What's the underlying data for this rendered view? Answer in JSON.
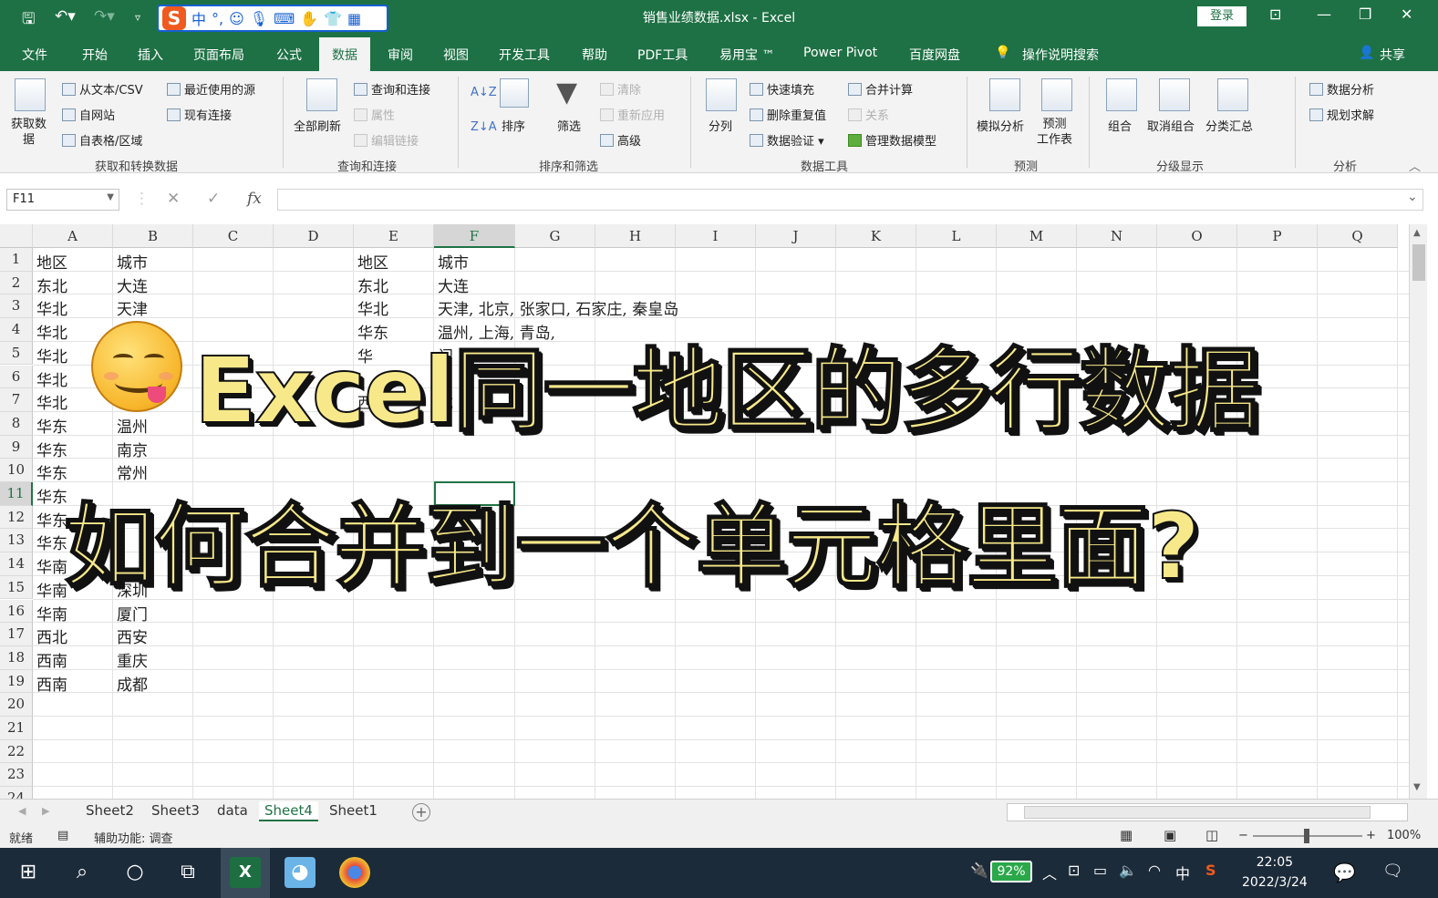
{
  "window": {
    "title": "销售业绩数据.xlsx  -  Excel",
    "login": "登录",
    "sogou_logo": "S",
    "sogou_mode": "中"
  },
  "tabs": [
    "文件",
    "开始",
    "插入",
    "页面布局",
    "公式",
    "数据",
    "审阅",
    "视图",
    "开发工具",
    "帮助",
    "PDF工具",
    "易用宝 ™",
    "Power Pivot",
    "百度网盘",
    "操作说明搜索"
  ],
  "share": "共享",
  "ribbon": {
    "get_data": "获取数\n据",
    "from_text": "从文本/CSV",
    "recent_sources": "最近使用的源",
    "from_web": "自网站",
    "existing_conn": "现有连接",
    "from_table": "自表格/区域",
    "group_get": "获取和转换数据",
    "refresh_all": "全部刷新",
    "queries_conn": "查询和连接",
    "properties": "属性",
    "edit_links": "编辑链接",
    "group_query": "查询和连接",
    "sort": "排序",
    "filter": "筛选",
    "clear": "清除",
    "reapply": "重新应用",
    "advanced": "高级",
    "group_sort": "排序和筛选",
    "text_to_col": "分列",
    "flash_fill": "快速填充",
    "remove_dup": "删除重复值",
    "data_validation": "数据验证",
    "consolidate": "合并计算",
    "relationships": "关系",
    "data_model": "管理数据模型",
    "group_tools": "数据工具",
    "what_if": "模拟分析",
    "forecast_sheet": "预测\n工作表",
    "group_forecast": "预测",
    "group_btn": "组合",
    "ungroup": "取消组合",
    "subtotal": "分类汇总",
    "group_outline": "分级显示",
    "data_analysis": "数据分析",
    "solver": "规划求解",
    "group_analysis": "分析"
  },
  "formula_bar": {
    "name_box": "F11",
    "fx": "fx",
    "cancel": "✕",
    "enter": "✓"
  },
  "columns": [
    "A",
    "B",
    "C",
    "D",
    "E",
    "F",
    "G",
    "H",
    "I",
    "J",
    "K",
    "L",
    "M",
    "N",
    "O",
    "P",
    "Q"
  ],
  "rows": [
    "1",
    "2",
    "3",
    "4",
    "5",
    "6",
    "7",
    "8",
    "9",
    "10",
    "11",
    "12",
    "13",
    "14",
    "15",
    "16",
    "17",
    "18",
    "19",
    "20",
    "21",
    "22",
    "23",
    "24"
  ],
  "cells": {
    "A": [
      "地区",
      "东北",
      "华北",
      "华北",
      "华北",
      "华北",
      "华北",
      "华东",
      "华东",
      "华东",
      "华东",
      "华东",
      "华东",
      "华南",
      "华南",
      "华南",
      "西北",
      "西南",
      "西南"
    ],
    "B": [
      "城市",
      "大连",
      "天津",
      "",
      "",
      "",
      "",
      "温州",
      "南京",
      "常州",
      "",
      "",
      "",
      "",
      "深圳",
      "厦门",
      "西安",
      "重庆",
      "成都"
    ],
    "E": [
      "地区",
      "东北",
      "华北",
      "华东",
      "华",
      "",
      "西"
    ],
    "F": [
      "城市",
      "大连",
      "天津, 北京, 张家口, 石家庄, 秦皇岛",
      "温州, 上海, 青岛, ",
      "门",
      "",
      "成"
    ]
  },
  "overlay": {
    "line1": "Excel同一地区的多行数据",
    "line2": "如何合并到一个单元格里面?"
  },
  "sheets": [
    "Sheet2",
    "Sheet3",
    "data",
    "Sheet4",
    "Sheet1"
  ],
  "active_sheet": "Sheet4",
  "status": {
    "ready": "就绪",
    "accessibility": "辅助功能: 调查",
    "zoom": "100%"
  },
  "taskbar": {
    "battery": "92%",
    "ime": "中",
    "time": "22:05",
    "date": "2022/3/24"
  },
  "colors": {
    "excel_green": "#1e7145",
    "accent": "#217346",
    "caption_fill": "#f7e98a"
  }
}
